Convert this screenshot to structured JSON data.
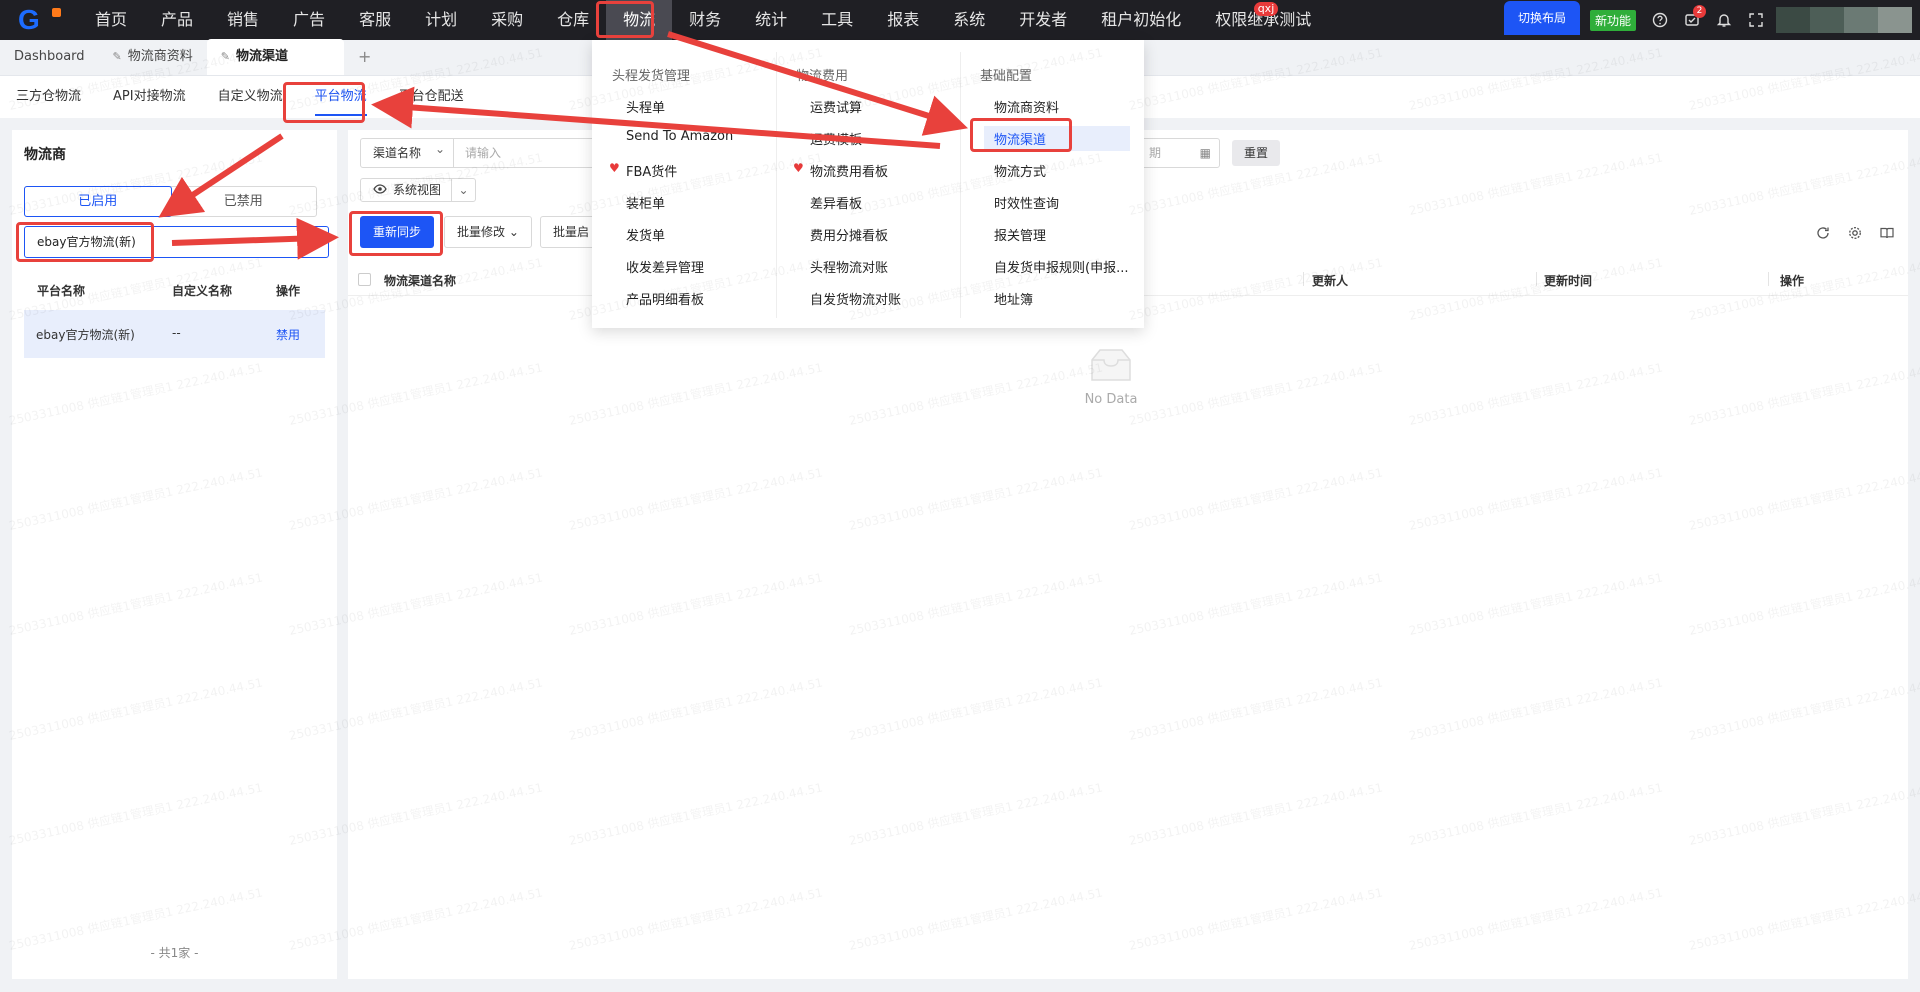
{
  "nav": {
    "items": [
      "首页",
      "产品",
      "销售",
      "广告",
      "客服",
      "计划",
      "采购",
      "仓库",
      "物流",
      "财务",
      "统计",
      "工具",
      "报表",
      "系统",
      "开发者",
      "租户初始化",
      "权限继承测试"
    ],
    "active_index": 8,
    "user_badge": "qxj",
    "switch_layout": "切换布局",
    "new_feature": "新功能",
    "task_count": "2"
  },
  "page_tabs": {
    "dashboard": "Dashboard",
    "tab1": "物流商资料",
    "tab2": "物流渠道",
    "plus": "+"
  },
  "sub_tabs": [
    "三方仓物流",
    "API对接物流",
    "自定义物流",
    "平台物流",
    "平台仓配送"
  ],
  "left": {
    "title": "物流商",
    "seg_on": "已启用",
    "seg_off": "已禁用",
    "search_value": "ebay官方物流(新)",
    "col_platform": "平台名称",
    "col_custom": "自定义名称",
    "col_action": "操作",
    "row_platform": "ebay官方物流(新)",
    "row_custom": "--",
    "row_action": "禁用",
    "footer": "- 共1家 -"
  },
  "main": {
    "filter_select": "渠道名称",
    "filter_placeholder": "请输入",
    "date_placeholder": "期",
    "reset": "重置",
    "view": "系统视图",
    "btn_sync": "重新同步",
    "btn_batch_edit": "批量修改",
    "btn_batch_enable": "批量启用",
    "col_channel": "物流渠道名称",
    "col_updater": "更新人",
    "col_update_time": "更新时间",
    "col_action": "操作",
    "no_data": "No Data"
  },
  "mega_menu": {
    "col1_title": "头程发货管理",
    "col1_items": [
      "头程单",
      "Send To Amazon",
      "FBA货件",
      "装柜单",
      "发货单",
      "收发差异管理",
      "产品明细看板"
    ],
    "col2_title": "物流费用",
    "col2_items": [
      "运费试算",
      "运费模板",
      "物流费用看板",
      "差异看板",
      "费用分摊看板",
      "头程物流对账",
      "自发货物流对账"
    ],
    "col3_title": "基础配置",
    "col3_items": [
      "物流商资料",
      "物流渠道",
      "物流方式",
      "时效性查询",
      "报关管理",
      "自发货申报规则(申报...",
      "地址簿"
    ]
  },
  "watermark": "2503311008 供应链1管理员1 222.240.44.51",
  "colors": {
    "primary": "#1d55f5",
    "nav_bg": "#1f1f24",
    "annotation": "#e8413c",
    "new_feature": "#2fae3a"
  }
}
